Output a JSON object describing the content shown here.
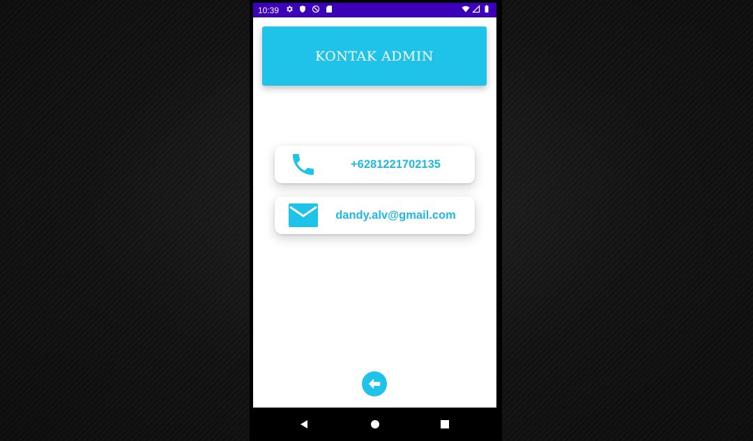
{
  "status_bar": {
    "time": "10:39",
    "left_icons": [
      "settings-icon",
      "shield-icon",
      "sync-icon",
      "sd-card-icon"
    ],
    "right_icons": [
      "wifi-icon",
      "signal-icon",
      "battery-icon"
    ]
  },
  "header": {
    "title": "KONTAK ADMIN"
  },
  "contacts": [
    {
      "icon": "phone-icon",
      "value": "+6281221702135"
    },
    {
      "icon": "email-icon",
      "value": "dandy.alv@gmail.com"
    }
  ],
  "back_button": {
    "icon": "arrow-left-icon"
  },
  "nav_bar": {
    "buttons": [
      "nav-back-icon",
      "nav-home-icon",
      "nav-recents-icon"
    ]
  },
  "colors": {
    "status_bar": "#3b00b8",
    "accent": "#1fc2e8",
    "text_accent": "#1fb8e3",
    "screen_bg": "#ffffff"
  }
}
